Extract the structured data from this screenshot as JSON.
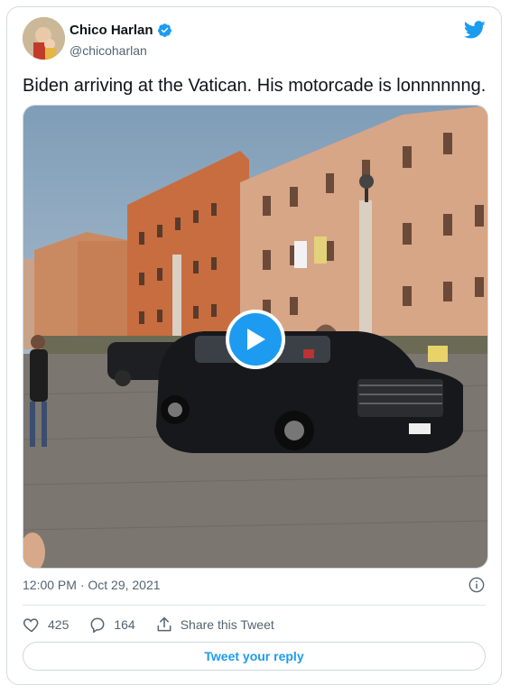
{
  "author": {
    "name": "Chico Harlan",
    "handle": "@chicoharlan",
    "verified": true
  },
  "tweet": {
    "text": "Biden arriving at the Vatican. His motorcade is lonnnnnng.",
    "timestamp": "12:00 PM · Oct 29, 2021"
  },
  "media": {
    "type": "video",
    "play_icon": "play-icon"
  },
  "actions": {
    "like_count": "425",
    "reply_count": "164",
    "share_label": "Share this Tweet"
  },
  "reply_button_label": "Tweet your reply",
  "colors": {
    "accent": "#1d9bf0",
    "secondary_text": "#536471",
    "border": "#cfd9de"
  }
}
